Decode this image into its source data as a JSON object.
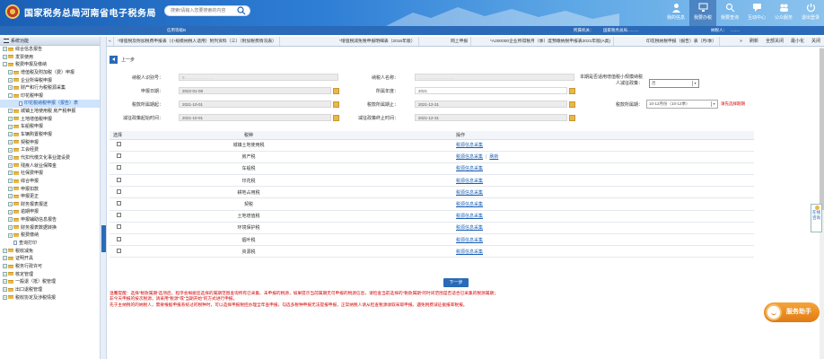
{
  "header": {
    "site_title": "国家税务总局河南省电子税务局",
    "search_placeholder": "搜索/请输入您要搜索的内容",
    "nav": [
      {
        "label": "我的信息",
        "icon": "user-icon"
      },
      {
        "label": "我要办税",
        "icon": "computer-icon",
        "active": true
      },
      {
        "label": "我要查询",
        "icon": "magnifier-icon"
      },
      {
        "label": "互动中心",
        "icon": "chat-icon"
      },
      {
        "label": "公众服务",
        "icon": "people-icon"
      },
      {
        "label": "退出登录",
        "icon": "logout-icon"
      }
    ]
  },
  "subbar": {
    "credit_label": "信用等级B",
    "institution_label": "所属机关：",
    "institution_value": "国家税务总局..........",
    "taxpayer_label": "纳税人：",
    "taxpayer_value": "........"
  },
  "sidebar": {
    "title": "系统功能",
    "items": [
      {
        "label": "综合信息报告",
        "level": 0,
        "expand": "+",
        "icon": "folder"
      },
      {
        "label": "发票使用",
        "level": 0,
        "expand": "+",
        "icon": "folder"
      },
      {
        "label": "税费申报及缴纳",
        "level": 0,
        "expand": "-",
        "icon": "folder"
      },
      {
        "label": "增值税及附加税（费）申报",
        "level": 1,
        "expand": "+",
        "icon": "folder"
      },
      {
        "label": "企业所得税申报",
        "level": 1,
        "expand": "+",
        "icon": "folder"
      },
      {
        "label": "财产和行为税税源采集",
        "level": 1,
        "expand": "+",
        "icon": "folder"
      },
      {
        "label": "印花税申报",
        "level": 1,
        "expand": "-",
        "icon": "folder"
      },
      {
        "label": "印花税纳税申报（报告）表",
        "level": 2,
        "expand": "",
        "icon": "doc",
        "selected": true
      },
      {
        "label": "城镇土地使用税 房产税申报",
        "level": 1,
        "expand": "+",
        "icon": "folder"
      },
      {
        "label": "土地增值税申报",
        "level": 1,
        "expand": "+",
        "icon": "folder"
      },
      {
        "label": "车船税申报",
        "level": 1,
        "expand": "+",
        "icon": "folder"
      },
      {
        "label": "车辆购置税申报",
        "level": 1,
        "expand": "+",
        "icon": "folder"
      },
      {
        "label": "契税申报",
        "level": 1,
        "expand": "+",
        "icon": "folder"
      },
      {
        "label": "工会经费",
        "level": 1,
        "expand": "+",
        "icon": "folder"
      },
      {
        "label": "代扣代缴文化事业建设费",
        "level": 1,
        "expand": "+",
        "icon": "folder"
      },
      {
        "label": "残疾人就业保障金",
        "level": 1,
        "expand": "+",
        "icon": "folder"
      },
      {
        "label": "社保费申报",
        "level": 1,
        "expand": "+",
        "icon": "folder"
      },
      {
        "label": "综合申报",
        "level": 1,
        "expand": "+",
        "icon": "folder"
      },
      {
        "label": "申报扣款",
        "level": 1,
        "expand": "+",
        "icon": "folder"
      },
      {
        "label": "申报更正",
        "level": 1,
        "expand": "+",
        "icon": "folder"
      },
      {
        "label": "财务报表报送",
        "level": 1,
        "expand": "+",
        "icon": "folder"
      },
      {
        "label": "逾期申报",
        "level": 1,
        "expand": "+",
        "icon": "folder"
      },
      {
        "label": "申报辅助信息报告",
        "level": 1,
        "expand": "+",
        "icon": "folder"
      },
      {
        "label": "财务报表数据转换",
        "level": 1,
        "expand": "+",
        "icon": "folder"
      },
      {
        "label": "税费缴纳",
        "level": 1,
        "expand": "+",
        "icon": "folder"
      },
      {
        "label": "查询打印",
        "level": 1,
        "expand": "",
        "icon": "doc"
      },
      {
        "label": "税收减免",
        "level": 0,
        "expand": "+",
        "icon": "folder"
      },
      {
        "label": "证明开具",
        "level": 0,
        "expand": "+",
        "icon": "folder"
      },
      {
        "label": "税务行政许可",
        "level": 0,
        "expand": "+",
        "icon": "folder"
      },
      {
        "label": "核定管理",
        "level": 0,
        "expand": "+",
        "icon": "folder"
      },
      {
        "label": "一般退（抵）税管理",
        "level": 0,
        "expand": "+",
        "icon": "folder"
      },
      {
        "label": "出口退税管理",
        "level": 0,
        "expand": "+",
        "icon": "folder"
      },
      {
        "label": "税收协定及涉税情报",
        "level": 0,
        "expand": "+",
        "icon": "folder"
      }
    ]
  },
  "tabs": [
    "*增值税及附加税费申报表（小规模纳税人适用）附列资料（三）（附加税费情况表）",
    "*增值税减免税申报明细表（2016年版）",
    "网上申报",
    "*A200000企业所得税月（季）度预缴纳税申报表2021年版(A类)",
    "印花税纳税申报（报告）表（月/季）",
    "印花税"
  ],
  "tab_controls": {
    "refresh": "刷新",
    "close_all": "全部关闭",
    "minimize": "最小化",
    "close": "关闭"
  },
  "toolbar": {
    "back_label": "上一步"
  },
  "form": {
    "taxpayer_id_label": "纳税人识别号：",
    "taxpayer_id_value": "9..............",
    "taxpayer_name_label": "纳税人名称：",
    "taxpayer_name_value": "..................",
    "small_scale_label": "本期是否适用增值税小规模纳税人减征政策：",
    "small_scale_value": "否",
    "report_date_label": "申报日期：",
    "report_date_value": "2022-01-08",
    "year_label": "所属年度：",
    "year_value": "2021",
    "period_label": "税款所属期：",
    "period_value": "10-12月份（10-12季）",
    "period_warning": "请先选择期期",
    "period_start_label": "税款所属期起：",
    "period_start_value": "2021-10-01",
    "period_end_label": "税款所属期止：",
    "period_end_value": "2021-12-31",
    "relief_start_label": "减征政策起始时间：",
    "relief_start_value": "2021-10-01",
    "relief_end_label": "减征政策终止时间：",
    "relief_end_value": "2021-12-31"
  },
  "grid": {
    "headers": [
      "选择",
      "税种",
      "操作"
    ],
    "rows": [
      {
        "tax": "城镇土地使用税",
        "ops": [
          "税源信息采集"
        ]
      },
      {
        "tax": "房产税",
        "ops": [
          "税源信息采集",
          "刷新"
        ]
      },
      {
        "tax": "车船税",
        "ops": [
          "税源信息采集"
        ]
      },
      {
        "tax": "印花税",
        "ops": [
          "税源信息采集"
        ]
      },
      {
        "tax": "耕地占用税",
        "ops": [
          "税源信息采集"
        ]
      },
      {
        "tax": "契税",
        "ops": [
          "税源信息采集"
        ]
      },
      {
        "tax": "土地增值税",
        "ops": [
          "税源信息采集"
        ]
      },
      {
        "tax": "环境保护税",
        "ops": [
          "税源信息采集"
        ]
      },
      {
        "tax": "烟叶税",
        "ops": [
          "税源信息采集"
        ]
      },
      {
        "tax": "资源税",
        "ops": [
          "税源信息采集"
        ]
      }
    ]
  },
  "next_button": "下一步",
  "tips": [
    "温馨提醒：选择“税款属期”选项后，程序会根据您选择的属期范围查询所有已采集、未申报的税源，如果提示当前属期无可申报的税源信息，请检查当前选择的“税款属期”的时间范围是否适合已采集的税源属期；",
    "非今天申报的按次税源，请采用“税源”或“当期开始”的方式进行申报。",
    "先于主纳税的的纳税人，需要根据申报系统过的税种时，可以选择申报税控办理全年查申报，勾选多税种申报无法提报申报，正常纳税人请从检查税源收取采取申报。遇免税费减征据报率税报。"
  ],
  "feedback": {
    "label": "在线咨询"
  },
  "assistant": {
    "label": "服务助手"
  }
}
